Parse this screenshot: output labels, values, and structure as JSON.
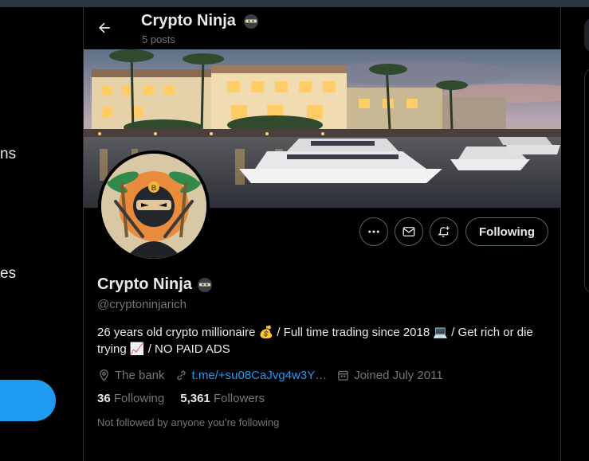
{
  "left_nav": {
    "fragment_1": "ns",
    "fragment_2": "es"
  },
  "header": {
    "title": "Crypto Ninja",
    "subtitle": "5 posts"
  },
  "actions": {
    "more_icon": "more-icon",
    "message_icon": "envelope-icon",
    "notify_icon": "bell-plus-icon",
    "following_label": "Following"
  },
  "profile": {
    "name": "Crypto Ninja",
    "handle": "@cryptoninjarich",
    "bio_line1": "26 years old crypto millionaire 💰 / Full time trading since 2018 💻 / Get rich or die",
    "bio_line2": "trying 📈 / NO PAID ADS",
    "location": "The bank",
    "link": "t.me/+su08CaJvg4w3Y…",
    "joined": "Joined July 2011",
    "following_count": "36",
    "following_label": "Following",
    "followers_count": "5,361",
    "followers_label": "Followers",
    "not_followed_text": "Not followed by anyone you’re following"
  },
  "colors": {
    "accent": "#1d9bf0",
    "muted_text": "#71767b",
    "border": "#2f3336"
  }
}
